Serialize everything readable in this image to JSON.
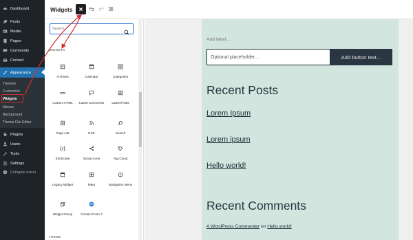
{
  "sidebar": {
    "items": [
      {
        "label": "Dashboard",
        "icon": "dashboard-icon"
      },
      {
        "label": "Posts",
        "icon": "pin-icon"
      },
      {
        "label": "Media",
        "icon": "media-icon"
      },
      {
        "label": "Pages",
        "icon": "page-icon"
      },
      {
        "label": "Comments",
        "icon": "comment-icon"
      },
      {
        "label": "Contact",
        "icon": "mail-icon"
      },
      {
        "label": "Appearance",
        "icon": "brush-icon"
      },
      {
        "label": "Plugins",
        "icon": "plugin-icon"
      },
      {
        "label": "Users",
        "icon": "user-icon"
      },
      {
        "label": "Tools",
        "icon": "wrench-icon"
      },
      {
        "label": "Settings",
        "icon": "settings-icon"
      },
      {
        "label": "Collapse menu",
        "icon": "collapse-icon"
      }
    ],
    "submenu": [
      "Themes",
      "Customize",
      "Widgets",
      "Menus",
      "Background",
      "Theme File Editor"
    ]
  },
  "header": {
    "title": "Widgets"
  },
  "inserter": {
    "search_placeholder": "Search",
    "section_label": "WIDGETS",
    "theme_label": "THEME",
    "blocks": [
      {
        "label": "Archives",
        "icon": "archive-icon"
      },
      {
        "label": "Calendar",
        "icon": "calendar-icon"
      },
      {
        "label": "Categories",
        "icon": "categories-icon"
      },
      {
        "label": "Custom HTML",
        "icon": "html-icon"
      },
      {
        "label": "Latest Comments",
        "icon": "latest-comments-icon"
      },
      {
        "label": "Latest Posts",
        "icon": "latest-posts-icon"
      },
      {
        "label": "Page List",
        "icon": "page-list-icon"
      },
      {
        "label": "RSS",
        "icon": "rss-icon"
      },
      {
        "label": "Search",
        "icon": "search-icon"
      },
      {
        "label": "Shortcode",
        "icon": "shortcode-icon"
      },
      {
        "label": "Social Icons",
        "icon": "share-icon"
      },
      {
        "label": "Tag Cloud",
        "icon": "tag-icon"
      },
      {
        "label": "Legacy Widget",
        "icon": "legacy-widget-icon"
      },
      {
        "label": "Meta",
        "icon": "meta-icon"
      },
      {
        "label": "Navigation Menu",
        "icon": "navigation-icon"
      },
      {
        "label": "Widget Group",
        "icon": "widget-group-icon"
      },
      {
        "label": "Contact Form 7",
        "icon": "contact-form-icon"
      }
    ]
  },
  "canvas": {
    "search_label": "Add label…",
    "search_placeholder": "Optional placeholder…",
    "search_button": "Add button text…",
    "recent_posts_heading": "Recent Posts",
    "posts": [
      "Lorem Ipsum",
      "Lorem ipsum",
      "Hello world!"
    ],
    "recent_comments_heading": "Recent Comments",
    "comment": {
      "author": "A WordPress Commenter",
      "on": "on",
      "post": "Hello world!"
    }
  },
  "colors": {
    "sidebar_bg": "#1d2327",
    "active_accent": "#2271b1",
    "widget_area_bg": "#d2e5df",
    "annotation": "#d32f2f"
  }
}
